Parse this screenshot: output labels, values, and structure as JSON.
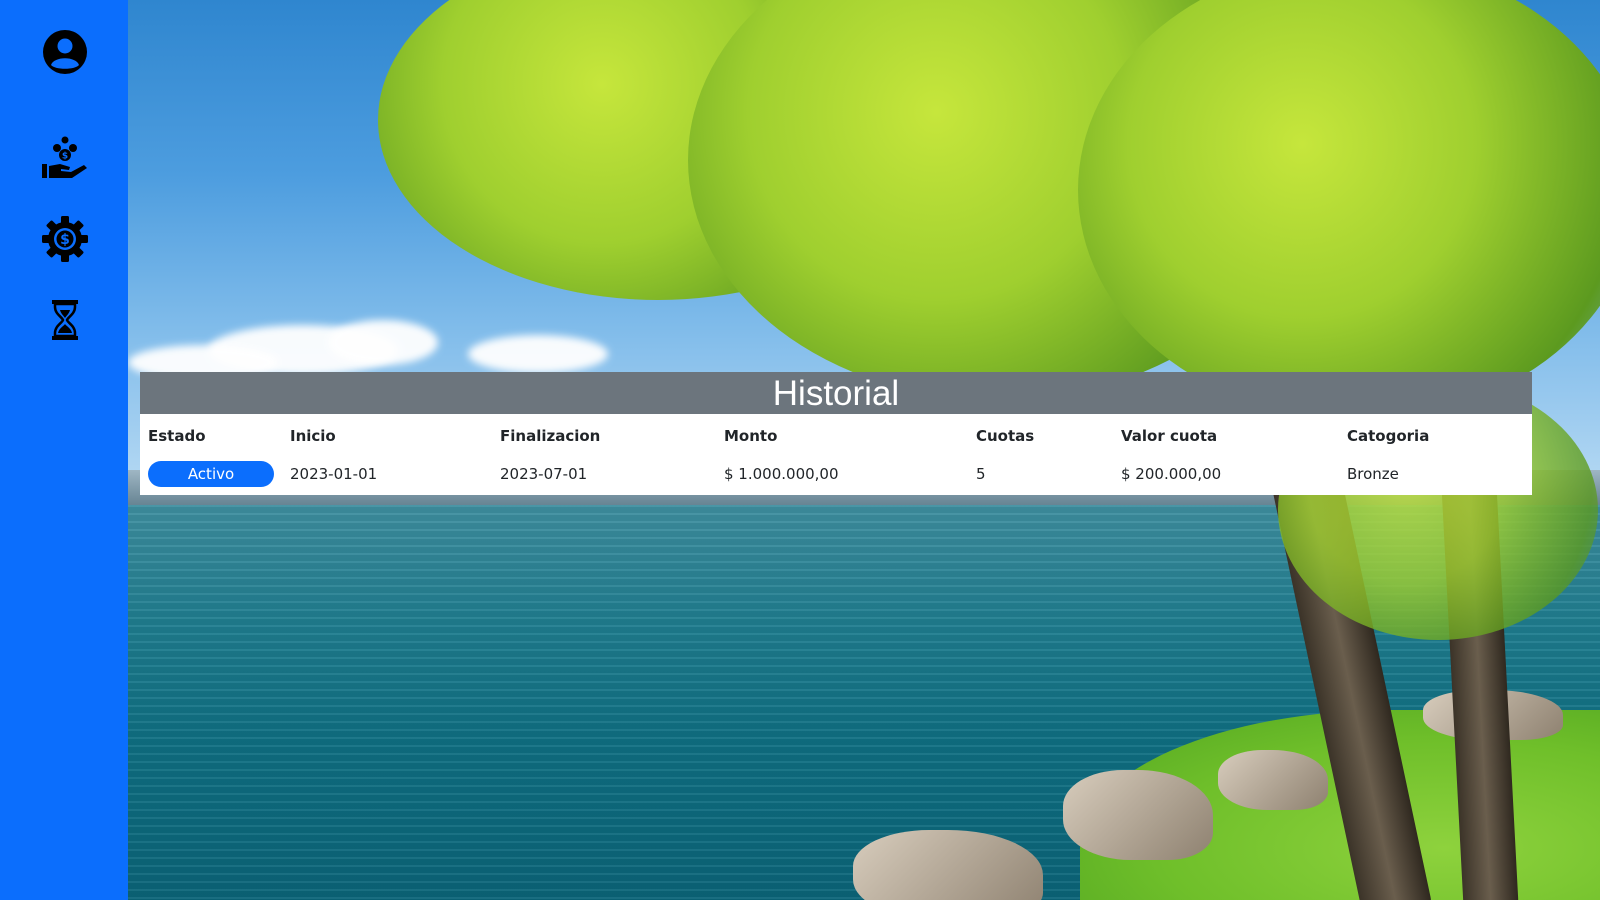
{
  "sidebar": {
    "items": [
      {
        "icon": "user-circle-icon"
      },
      {
        "icon": "hand-coins-icon"
      },
      {
        "icon": "gear-dollar-icon"
      },
      {
        "icon": "hourglass-icon"
      }
    ],
    "color": "#0b6efd"
  },
  "history": {
    "title": "Historial",
    "header_color": "#6c757d",
    "columns": [
      "Estado",
      "Inicio",
      "Finalizacion",
      "Monto",
      "Cuotas",
      "Valor cuota",
      "Catogoria"
    ],
    "rows": [
      {
        "estado": "Activo",
        "inicio": "2023-01-01",
        "finalizacion": "2023-07-01",
        "monto": "$ 1.000.000,00",
        "cuotas": "5",
        "valor_cuota": "$ 200.000,00",
        "categoria": "Bronze"
      }
    ]
  }
}
